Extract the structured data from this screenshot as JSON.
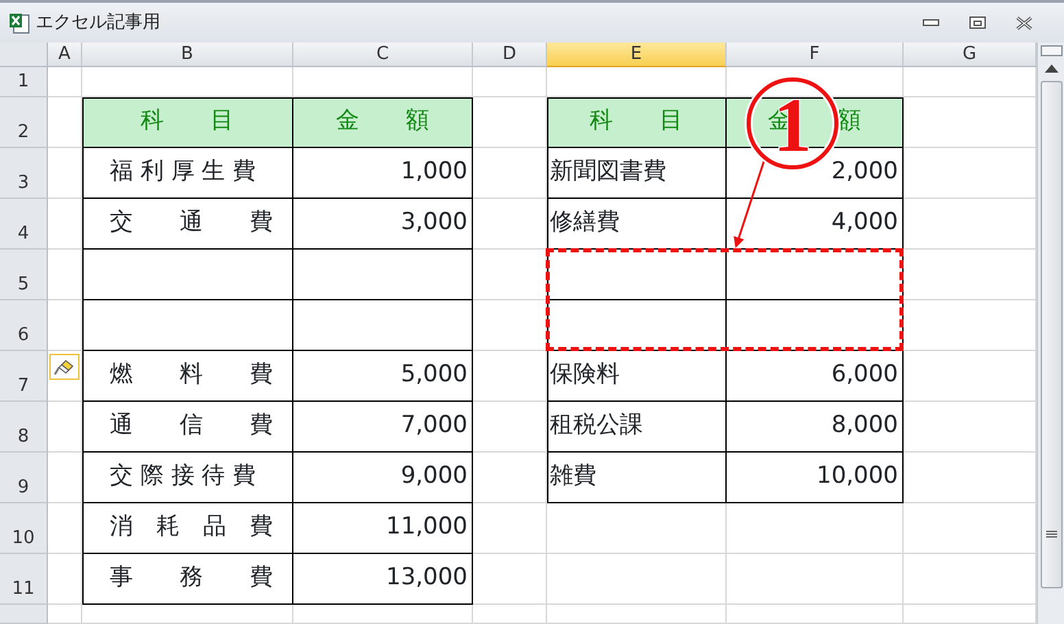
{
  "window": {
    "title": "エクセル記事用"
  },
  "columns": [
    {
      "label": "A",
      "selected": false
    },
    {
      "label": "B",
      "selected": false
    },
    {
      "label": "C",
      "selected": false
    },
    {
      "label": "D",
      "selected": false
    },
    {
      "label": "E",
      "selected": true
    },
    {
      "label": "F",
      "selected": false
    },
    {
      "label": "G",
      "selected": false
    }
  ],
  "rows": [
    "1",
    "2",
    "3",
    "4",
    "5",
    "6",
    "7",
    "8",
    "9",
    "10",
    "11"
  ],
  "left_table": {
    "header": [
      "科　　目",
      "金　　額"
    ],
    "rows": [
      {
        "item": "福 利 厚 生 費",
        "amount": "1,000"
      },
      {
        "item": "交　　通　　費",
        "amount": "3,000"
      },
      {},
      {},
      {
        "item": "燃　　料　　費",
        "amount": "5,000"
      },
      {
        "item": "通　　信　　費",
        "amount": "7,000"
      },
      {
        "item": "交 際 接 待 費",
        "amount": "9,000"
      },
      {
        "item": "消　耗　品　費",
        "amount": "11,000"
      },
      {
        "item": "事　　務　　費",
        "amount": "13,000"
      }
    ]
  },
  "right_table": {
    "header": [
      "科　　目",
      "金　　額"
    ],
    "rows": [
      {
        "item": "新聞図書費",
        "amount": "2,000",
        "marked": false
      },
      {
        "item": "修繕費",
        "amount": "4,000",
        "marked": false
      },
      {
        "marked": true
      },
      {
        "marked": true
      },
      {
        "item": "保険料",
        "amount": "6,000",
        "marked": false
      },
      {
        "item": "租税公課",
        "amount": "8,000",
        "marked": false
      },
      {
        "item": "雑費",
        "amount": "10,000",
        "marked": false
      }
    ]
  },
  "callout": {
    "label": "1"
  }
}
